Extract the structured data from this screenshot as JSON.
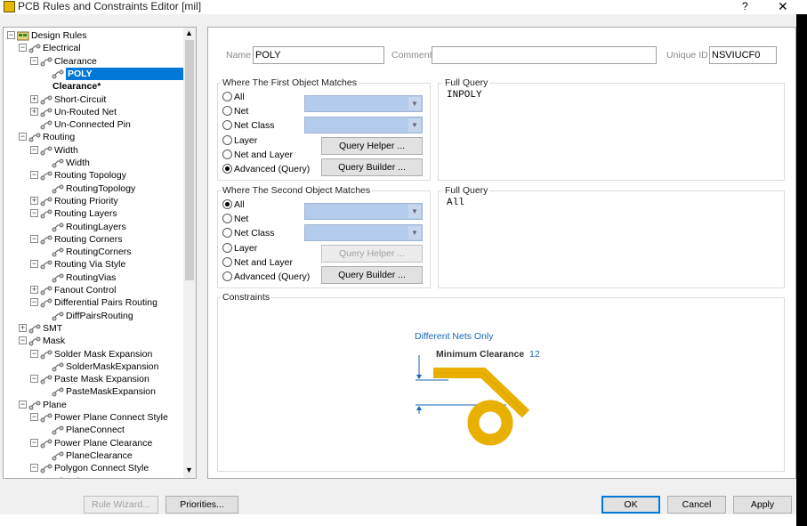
{
  "window": {
    "title": "PCB Rules and Constraints Editor [mil]",
    "help": "?",
    "close": "✕"
  },
  "tree": [
    {
      "label": "Design Rules",
      "level": 0,
      "icon": "rules-folder-icon",
      "expander": "−"
    },
    {
      "label": "Electrical",
      "level": 1,
      "icon": "electrical-icon",
      "expander": "−"
    },
    {
      "label": "Clearance",
      "level": 2,
      "icon": "clearance-icon",
      "expander": "−"
    },
    {
      "label": "POLY",
      "level": 3,
      "icon": "rule-icon",
      "expander": "",
      "selected": true
    },
    {
      "label": "Clearance*",
      "level": 3,
      "icon": "",
      "expander": "",
      "bold": true
    },
    {
      "label": "Short-Circuit",
      "level": 2,
      "icon": "short-circuit-icon",
      "expander": "+"
    },
    {
      "label": "Un-Routed Net",
      "level": 2,
      "icon": "unrouted-net-icon",
      "expander": "+"
    },
    {
      "label": "Un-Connected Pin",
      "level": 2,
      "icon": "unconnected-pin-icon",
      "expander": ""
    },
    {
      "label": "Routing",
      "level": 1,
      "icon": "routing-icon",
      "expander": "−"
    },
    {
      "label": "Width",
      "level": 2,
      "icon": "width-icon",
      "expander": "−"
    },
    {
      "label": "Width",
      "level": 3,
      "icon": "rule-icon",
      "expander": ""
    },
    {
      "label": "Routing Topology",
      "level": 2,
      "icon": "topology-icon",
      "expander": "−"
    },
    {
      "label": "RoutingTopology",
      "level": 3,
      "icon": "rule-icon",
      "expander": ""
    },
    {
      "label": "Routing Priority",
      "level": 2,
      "icon": "priority-icon",
      "expander": "+"
    },
    {
      "label": "Routing Layers",
      "level": 2,
      "icon": "layers-icon",
      "expander": "−"
    },
    {
      "label": "RoutingLayers",
      "level": 3,
      "icon": "rule-icon",
      "expander": ""
    },
    {
      "label": "Routing Corners",
      "level": 2,
      "icon": "corners-icon",
      "expander": "−"
    },
    {
      "label": "RoutingCorners",
      "level": 3,
      "icon": "rule-icon",
      "expander": ""
    },
    {
      "label": "Routing Via Style",
      "level": 2,
      "icon": "via-icon",
      "expander": "−"
    },
    {
      "label": "RoutingVias",
      "level": 3,
      "icon": "rule-icon",
      "expander": ""
    },
    {
      "label": "Fanout Control",
      "level": 2,
      "icon": "fanout-icon",
      "expander": "+"
    },
    {
      "label": "Differential Pairs Routing",
      "level": 2,
      "icon": "diffpair-icon",
      "expander": "−"
    },
    {
      "label": "DiffPairsRouting",
      "level": 3,
      "icon": "rule-icon",
      "expander": ""
    },
    {
      "label": "SMT",
      "level": 1,
      "icon": "smt-icon",
      "expander": "+"
    },
    {
      "label": "Mask",
      "level": 1,
      "icon": "mask-icon",
      "expander": "−"
    },
    {
      "label": "Solder Mask Expansion",
      "level": 2,
      "icon": "solder-mask-icon",
      "expander": "−"
    },
    {
      "label": "SolderMaskExpansion",
      "level": 3,
      "icon": "rule-icon",
      "expander": ""
    },
    {
      "label": "Paste Mask Expansion",
      "level": 2,
      "icon": "paste-mask-icon",
      "expander": "−"
    },
    {
      "label": "PasteMaskExpansion",
      "level": 3,
      "icon": "rule-icon",
      "expander": ""
    },
    {
      "label": "Plane",
      "level": 1,
      "icon": "plane-icon",
      "expander": "−"
    },
    {
      "label": "Power Plane Connect Style",
      "level": 2,
      "icon": "plane-connect-icon",
      "expander": "−"
    },
    {
      "label": "PlaneConnect",
      "level": 3,
      "icon": "rule-icon",
      "expander": ""
    },
    {
      "label": "Power Plane Clearance",
      "level": 2,
      "icon": "plane-clearance-icon",
      "expander": "−"
    },
    {
      "label": "PlaneClearance",
      "level": 3,
      "icon": "rule-icon",
      "expander": ""
    },
    {
      "label": "Polygon Connect Style",
      "level": 2,
      "icon": "polygon-icon",
      "expander": "−"
    },
    {
      "label": "PolygonConnect",
      "level": 3,
      "icon": "rule-icon",
      "expander": ""
    }
  ],
  "rule": {
    "name_label": "Name",
    "name_value": "POLY",
    "comment_label": "Comment",
    "comment_value": "",
    "uid_label": "Unique ID",
    "uid_value": "NSVIUCF0"
  },
  "first": {
    "title": "Where The First Object Matches",
    "options": [
      "All",
      "Net",
      "Net Class",
      "Layer",
      "Net and Layer",
      "Advanced (Query)"
    ],
    "selected": 5,
    "query_helper": "Query Helper ...",
    "query_builder": "Query Builder ...",
    "full_query_title": "Full Query",
    "full_query": "INPOLY"
  },
  "second": {
    "title": "Where The Second Object Matches",
    "options": [
      "All",
      "Net",
      "Net Class",
      "Layer",
      "Net and Layer",
      "Advanced (Query)"
    ],
    "selected": 0,
    "query_helper": "Query Helper ...",
    "query_builder": "Query Builder ...",
    "full_query_title": "Full Query",
    "full_query": "All"
  },
  "constraints": {
    "title": "Constraints",
    "different_nets": "Different Nets Only",
    "min_clearance_label": "Minimum Clearance",
    "min_clearance_value": "12"
  },
  "buttons": {
    "rule_wizard": "Rule Wizard...",
    "priorities": "Priorities...",
    "ok": "OK",
    "cancel": "Cancel",
    "apply": "Apply"
  },
  "colors": {
    "selection": "#0078d7",
    "track": "#e8b000",
    "dimension": "#1566b4",
    "combo": "#b3ccec"
  }
}
